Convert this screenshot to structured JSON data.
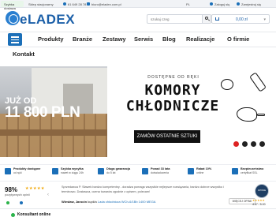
{
  "topbar": {
    "delivery_label": "Szybka dostawa",
    "stock_label": "Sklep stacjonarny",
    "phone": "61 649 28 78",
    "email": "biuro@eladex.com.pl",
    "language": "PL",
    "login": "Zaloguj się",
    "register": "Zarejestruj się"
  },
  "header": {
    "logo_text": "eLADEX",
    "search": {
      "value": "",
      "placeholder": "szukaj czeg"
    },
    "cart": {
      "value": "0,00 zł"
    }
  },
  "nav": {
    "items": [
      "Produkty",
      "Branże",
      "Zestawy",
      "Serwis",
      "Blog",
      "Realizacje",
      "O firmie"
    ],
    "second_row": [
      "Kontakt"
    ]
  },
  "hero": {
    "photo_line1": "JUŻ OD",
    "photo_line2": "11 800 PLN",
    "subtitle": "DOSTĘPNE OD RĘKI",
    "title_line1": "KOMORY",
    "title_line2": "CHŁODNICZE",
    "cta": "ZAMÓW OSTATNIE SZTUKI"
  },
  "features": [
    {
      "title": "Produkty dostępne",
      "subtitle": "od ręki"
    },
    {
      "title": "Szybka wysyłka",
      "subtitle": "nawet w ciągu 24h"
    },
    {
      "title": "Długa gwarancja",
      "subtitle": "do 5 lat"
    },
    {
      "title": "Ponad 33 lata",
      "subtitle": "doświadczenia"
    },
    {
      "title": "Rabat 10%",
      "subtitle": "online"
    },
    {
      "title": "Bezpieczeństwo",
      "subtitle": "certyfikat SSL"
    }
  ],
  "reviews": {
    "percent": "98%",
    "stars": "★★★★★",
    "subtitle": "pozytywnych opinii",
    "quote": "Sprzedawca P. Sławek bardzo kompetentny - doradza pomaga wszystkie nejlepsze rozwiązania, bardzo dobrze wszystko i terminowo. Dostawca, ocena towarów zgodnie z opisem, polecam!",
    "author": "Wiesław, Jarocin",
    "bought_label": "kupił/a",
    "product": "Lada chłodnicza WCh-6/1Bb 1400 MEGA",
    "more_button": "WIĘCEJ OPINII"
  },
  "badge": {
    "seal_text": "OPINIE",
    "stars": "★★★★★",
    "score": "4.67 / 5.00"
  },
  "chat": {
    "label": "Konsultant online"
  },
  "colors": {
    "brand": "#1b6fb8",
    "cta_bg": "#111111",
    "star": "#f0a500",
    "online": "#2bb34a"
  }
}
